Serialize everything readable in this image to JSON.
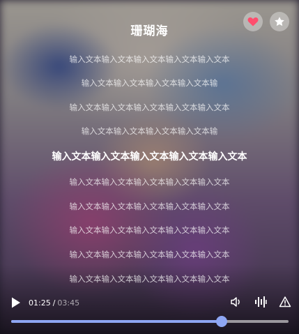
{
  "player": {
    "song_title": "珊瑚海",
    "liked": true,
    "favorite": false,
    "colors": {
      "accent": "#8ea6f3",
      "heart": "#ff4d6d"
    }
  },
  "lyrics": {
    "active_index": 4,
    "lines": [
      "输入文本输入文本输入文本输入文本输入文本",
      "输入文本输入文本输入文本输入文本输",
      "输入文本输入文本输入文本输入文本输入文本",
      "输入文本输入文本输入文本输入文本输",
      "输入文本输入文本输入文本输入文本输入文本",
      "输入文本输入文本输入文本输入文本输入文本",
      "输入文本输入文本输入文本输入文本输入文本",
      "输入文本输入文本输入文本输入文本输入文本",
      "输入文本输入文本输入文本输入文本输入文本",
      "输入文本输入文本输入文本输入文本输入文本"
    ]
  },
  "playback": {
    "current_time": "01:25",
    "separator": "/",
    "total_time": "03:45",
    "progress_fraction": 0.76,
    "icons": [
      "play-icon",
      "volume-icon",
      "sound-wave-icon",
      "warning-icon"
    ]
  }
}
